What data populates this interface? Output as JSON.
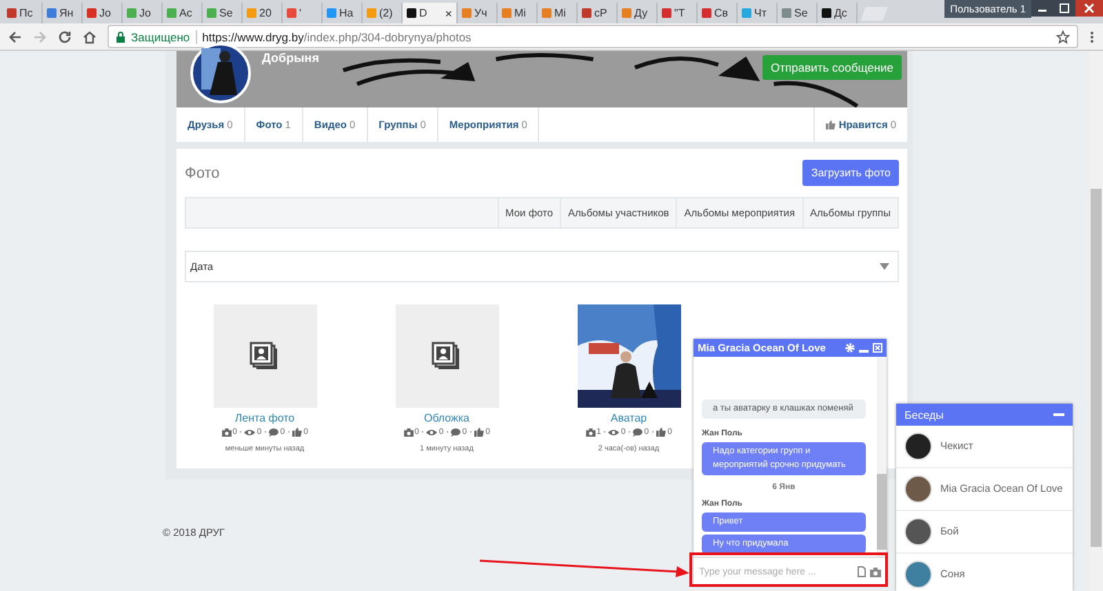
{
  "browser": {
    "tabs": [
      {
        "label": "Пс",
        "color": "#c0392b",
        "selected": false
      },
      {
        "label": "Ян",
        "color": "#3b7dd8",
        "selected": false
      },
      {
        "label": "Jo",
        "color": "#d93025",
        "selected": false
      },
      {
        "label": "Jo",
        "color": "#4caf50",
        "selected": false
      },
      {
        "label": "Ac",
        "color": "#4caf50",
        "selected": false
      },
      {
        "label": "Se",
        "color": "#4caf50",
        "selected": false
      },
      {
        "label": "20",
        "color": "#f39c12",
        "selected": false
      },
      {
        "label": "'",
        "color": "#e74c3c",
        "selected": false
      },
      {
        "label": "На",
        "color": "#2196f3",
        "selected": false
      },
      {
        "label": "(2)",
        "color": "#f39c12",
        "selected": false
      },
      {
        "label": "D",
        "color": "#111111",
        "selected": true
      },
      {
        "label": "Уч",
        "color": "#e67e22",
        "selected": false
      },
      {
        "label": "Mi",
        "color": "#e67e22",
        "selected": false
      },
      {
        "label": "Mi",
        "color": "#e67e22",
        "selected": false
      },
      {
        "label": "сР",
        "color": "#c0392b",
        "selected": false
      },
      {
        "label": "Ду",
        "color": "#e67e22",
        "selected": false
      },
      {
        "label": "\"Т",
        "color": "#d32f2f",
        "selected": false
      },
      {
        "label": "Св",
        "color": "#d32f2f",
        "selected": false
      },
      {
        "label": "Чт",
        "color": "#29a8e0",
        "selected": false
      },
      {
        "label": "Se",
        "color": "#7f8c8d",
        "selected": false
      },
      {
        "label": "Дс",
        "color": "#111111",
        "selected": false
      }
    ],
    "close_tab": "×",
    "user_button": "Пользователь 1",
    "address": {
      "security": "Защищено",
      "url_host": "https://www.dryg.by",
      "url_path": "/index.php/304-dobrynya/photos"
    }
  },
  "profile": {
    "name": "Добрыня",
    "message_button": "Отправить сообщение",
    "nav": [
      {
        "label": "Друзья",
        "count": "0"
      },
      {
        "label": "Фото",
        "count": "1"
      },
      {
        "label": "Видео",
        "count": "0"
      },
      {
        "label": "Группы",
        "count": "0"
      },
      {
        "label": "Мероприятия",
        "count": "0"
      }
    ],
    "like": {
      "label": "Нравится",
      "count": "0"
    }
  },
  "photos": {
    "title": "Фото",
    "upload_button": "Загрузить фото",
    "tabs": [
      "Мои фото",
      "Альбомы участников",
      "Альбомы мероприятия",
      "Альбомы группы"
    ],
    "sort": {
      "value": "Дата"
    },
    "albums": [
      {
        "kind": "placeholder",
        "title": "Лента фото",
        "stats": [
          {
            "kind": "photos",
            "value": "0"
          },
          {
            "kind": "views",
            "value": "0"
          },
          {
            "kind": "comments",
            "value": "0"
          },
          {
            "kind": "likes",
            "value": "0"
          }
        ],
        "time": "меньше минуты назад"
      },
      {
        "kind": "placeholder",
        "title": "Обложка",
        "stats": [
          {
            "kind": "photos",
            "value": "0"
          },
          {
            "kind": "views",
            "value": "0"
          },
          {
            "kind": "comments",
            "value": "0"
          },
          {
            "kind": "likes",
            "value": "0"
          }
        ],
        "time": "1 минуту назад"
      },
      {
        "kind": "picture",
        "title": "Аватар",
        "stats": [
          {
            "kind": "photos",
            "value": "1"
          },
          {
            "kind": "views",
            "value": "0"
          },
          {
            "kind": "comments",
            "value": "0"
          },
          {
            "kind": "likes",
            "value": "0"
          }
        ],
        "time": "2 часа(-ов) назад"
      }
    ]
  },
  "footer": "© 2018 ДРУГ",
  "chat": {
    "title": "Mia Gracia Ocean Of Love",
    "messages": [
      {
        "kind": "incoming",
        "text": "а ты аватарку в клашках поменяй"
      },
      {
        "kind": "author",
        "text": "Жан Поль"
      },
      {
        "kind": "outgoing",
        "text": "Надо категории групп и мероприятий срочно придумать"
      },
      {
        "kind": "date",
        "text": "6 Янв"
      },
      {
        "kind": "author",
        "text": "Жан Поль"
      },
      {
        "kind": "outgoing",
        "text": "Привет"
      },
      {
        "kind": "outgoing",
        "text": "Ну что придумала"
      }
    ],
    "input": {
      "placeholder": "Type your message here ..."
    }
  },
  "conversations": {
    "title": "Беседы",
    "items": [
      {
        "name": "Чекист",
        "color": "#222222"
      },
      {
        "name": "Mia Gracia Ocean Of Love",
        "color": "#6d5a48"
      },
      {
        "name": "Бой",
        "color": "#555555"
      },
      {
        "name": "Соня",
        "color": "#3f7f9f"
      }
    ]
  }
}
